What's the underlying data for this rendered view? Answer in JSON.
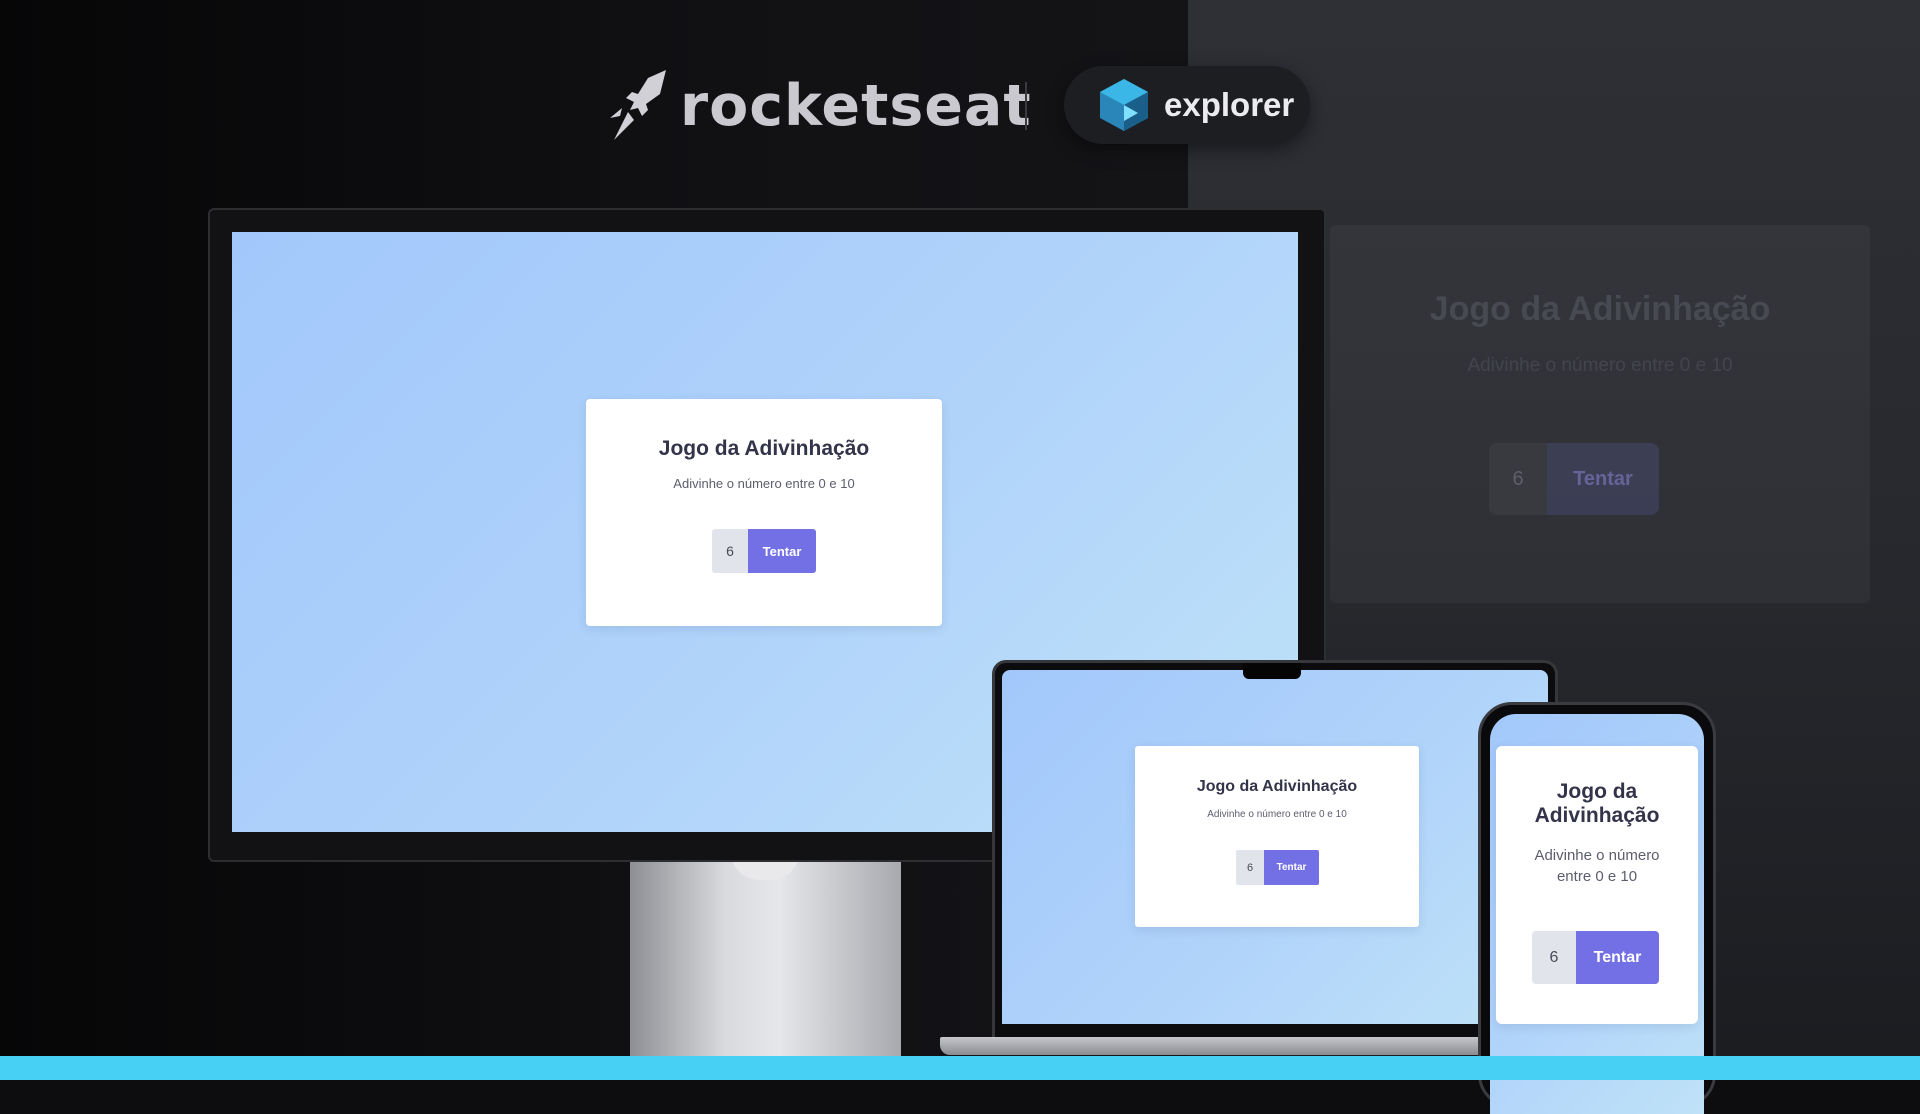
{
  "header": {
    "brand_name": "rocketseat",
    "product_name": "explorer"
  },
  "game": {
    "title": "Jogo da Adivinhação",
    "subtitle": "Adivinhe o número entre 0 e 10",
    "input_value": "6",
    "button_label": "Tentar"
  },
  "colors": {
    "accent_button": "#7370e6",
    "bottom_bar": "#47cff4",
    "background_dark": "#0d0d0f"
  },
  "icons": {
    "brand_logo": "rocket-icon",
    "product_logo": "explorer-cube-icon"
  }
}
